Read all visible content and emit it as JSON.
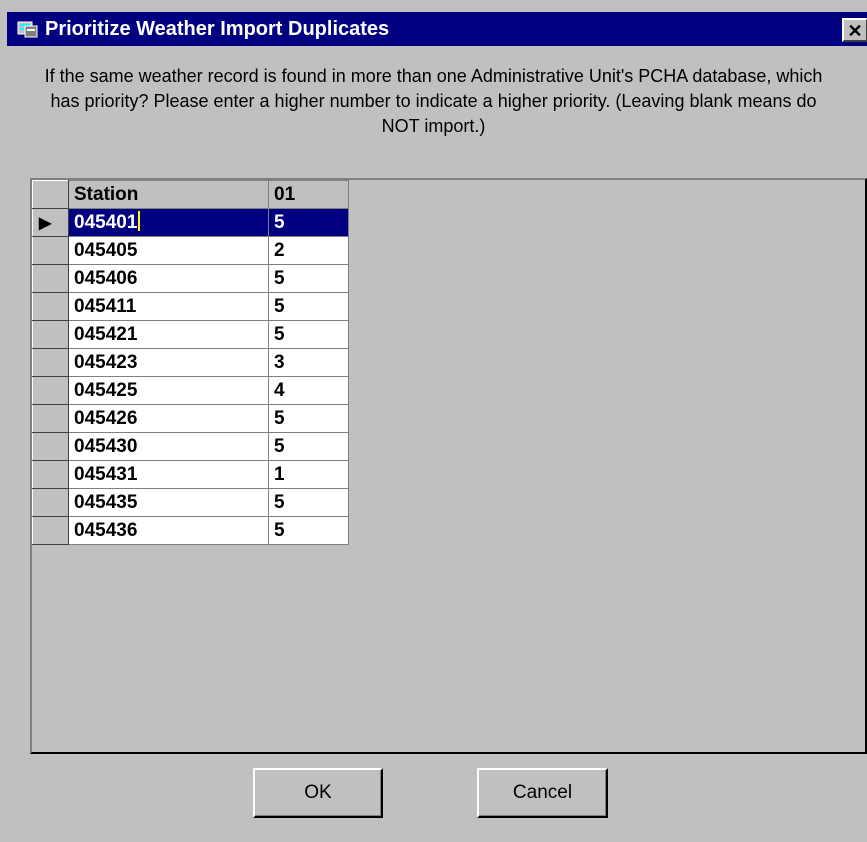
{
  "window": {
    "title": "Prioritize Weather Import Duplicates",
    "close_label": "✕"
  },
  "instructions": "If the same weather record is found in more than one Administrative Unit's PCHA database, which has priority? Please enter a higher number to indicate a higher priority. (Leaving blank means do NOT import.)",
  "grid": {
    "columns": [
      "Station",
      "01"
    ],
    "rows": [
      {
        "station": "045401",
        "value": "5"
      },
      {
        "station": "045405",
        "value": "2"
      },
      {
        "station": "045406",
        "value": "5"
      },
      {
        "station": "045411",
        "value": "5"
      },
      {
        "station": "045421",
        "value": "5"
      },
      {
        "station": "045423",
        "value": "3"
      },
      {
        "station": "045425",
        "value": "4"
      },
      {
        "station": "045426",
        "value": "5"
      },
      {
        "station": "045430",
        "value": "5"
      },
      {
        "station": "045431",
        "value": "1"
      },
      {
        "station": "045435",
        "value": "5"
      },
      {
        "station": "045436",
        "value": "5"
      }
    ],
    "current_row_indicator": "▶"
  },
  "buttons": {
    "ok": "OK",
    "cancel": "Cancel"
  },
  "colors": {
    "titlebar": "#000080",
    "selection": "#000080",
    "face": "#c0c0c0"
  }
}
